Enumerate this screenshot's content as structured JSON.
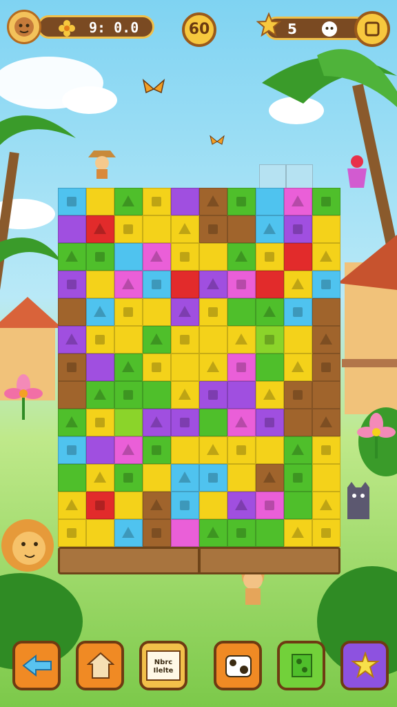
{
  "hud": {
    "score": "9: 0.0",
    "timer": "60",
    "stars": "5"
  },
  "toolbar": {
    "buttons": [
      {
        "icon": "back-arrow-icon",
        "label": ""
      },
      {
        "icon": "house-icon",
        "label": ""
      },
      {
        "icon": "card-icon",
        "label": "Nbrc Ilelte"
      },
      {
        "icon": "cow-icon",
        "label": ""
      },
      {
        "icon": "puzzle-icon",
        "label": ""
      },
      {
        "icon": "star-burst-icon",
        "label": ""
      }
    ]
  },
  "colors": {
    "yellow": "#f4d21a",
    "green": "#4fbf2b",
    "lime": "#8bd42a",
    "purple": "#a04fe0",
    "magenta": "#ea5fd8",
    "red": "#e22b2b",
    "cyan": "#4fc3ef",
    "brown": "#a0642c",
    "orange": "#f08a24"
  },
  "board": {
    "rows": [
      [
        "cyan",
        "yellow",
        "green",
        "yellow",
        "purple",
        "brown",
        "green",
        "cyan",
        "magenta",
        "green"
      ],
      [
        "purple",
        "red",
        "yellow",
        "yellow",
        "yellow",
        "brown",
        "brown",
        "cyan",
        "purple",
        "yellow"
      ],
      [
        "green",
        "green",
        "cyan",
        "magenta",
        "yellow",
        "yellow",
        "green",
        "yellow",
        "red",
        "yellow"
      ],
      [
        "purple",
        "yellow",
        "magenta",
        "cyan",
        "red",
        "purple",
        "magenta",
        "red",
        "yellow",
        "cyan"
      ],
      [
        "brown",
        "cyan",
        "yellow",
        "yellow",
        "purple",
        "yellow",
        "green",
        "green",
        "cyan",
        "brown"
      ],
      [
        "purple",
        "yellow",
        "yellow",
        "green",
        "yellow",
        "yellow",
        "yellow",
        "lime",
        "yellow",
        "brown"
      ],
      [
        "brown",
        "purple",
        "green",
        "yellow",
        "yellow",
        "yellow",
        "magenta",
        "green",
        "yellow",
        "brown"
      ],
      [
        "brown",
        "green",
        "green",
        "green",
        "yellow",
        "purple",
        "purple",
        "yellow",
        "brown",
        "brown"
      ],
      [
        "green",
        "yellow",
        "lime",
        "purple",
        "purple",
        "green",
        "magenta",
        "purple",
        "brown",
        "brown"
      ],
      [
        "cyan",
        "purple",
        "magenta",
        "green",
        "yellow",
        "yellow",
        "yellow",
        "yellow",
        "green",
        "yellow"
      ],
      [
        "green",
        "yellow",
        "green",
        "yellow",
        "cyan",
        "cyan",
        "yellow",
        "brown",
        "green",
        "yellow"
      ],
      [
        "yellow",
        "red",
        "yellow",
        "brown",
        "cyan",
        "yellow",
        "purple",
        "magenta",
        "green",
        "yellow"
      ],
      [
        "yellow",
        "yellow",
        "cyan",
        "brown",
        "magenta",
        "green",
        "green",
        "green",
        "yellow",
        "yellow"
      ]
    ]
  }
}
